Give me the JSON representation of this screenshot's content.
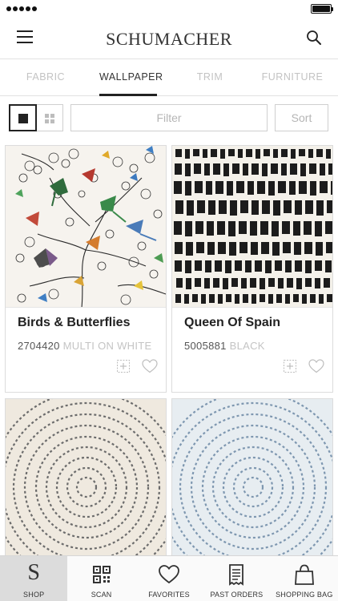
{
  "header": {
    "brand": "SCHUMACHER"
  },
  "tabs": [
    {
      "label": "FABRIC",
      "active": false
    },
    {
      "label": "WALLPAPER",
      "active": true
    },
    {
      "label": "TRIM",
      "active": false
    },
    {
      "label": "FURNITURE",
      "active": false
    }
  ],
  "toolbar": {
    "filter_label": "Filter",
    "sort_label": "Sort",
    "view_mode": "single"
  },
  "products": [
    {
      "name": "Birds & Butterflies",
      "sku": "2704420",
      "color": "MULTI ON WHITE",
      "pattern": "birds-butterflies-multi"
    },
    {
      "name": "Queen Of Spain",
      "sku": "5005881",
      "color": "BLACK",
      "pattern": "brushstroke-black"
    },
    {
      "name": "",
      "sku": "",
      "color": "",
      "pattern": "concentric-scallop-grey"
    },
    {
      "name": "",
      "sku": "",
      "color": "",
      "pattern": "concentric-scallop-blue"
    }
  ],
  "bottom_nav": [
    {
      "label": "SHOP",
      "icon": "schumacher-s-icon",
      "active": true
    },
    {
      "label": "SCAN",
      "icon": "qr-code-icon",
      "active": false
    },
    {
      "label": "FAVORITES",
      "icon": "heart-icon",
      "active": false
    },
    {
      "label": "PAST ORDERS",
      "icon": "receipt-icon",
      "active": false
    },
    {
      "label": "SHOPPING BAG",
      "icon": "shopping-bag-icon",
      "active": false
    }
  ],
  "colors": {
    "accent": "#222222",
    "inactive_text": "#c3c3c3",
    "border": "#dcdcdc",
    "nav_active_bg": "#dcdcdc"
  }
}
